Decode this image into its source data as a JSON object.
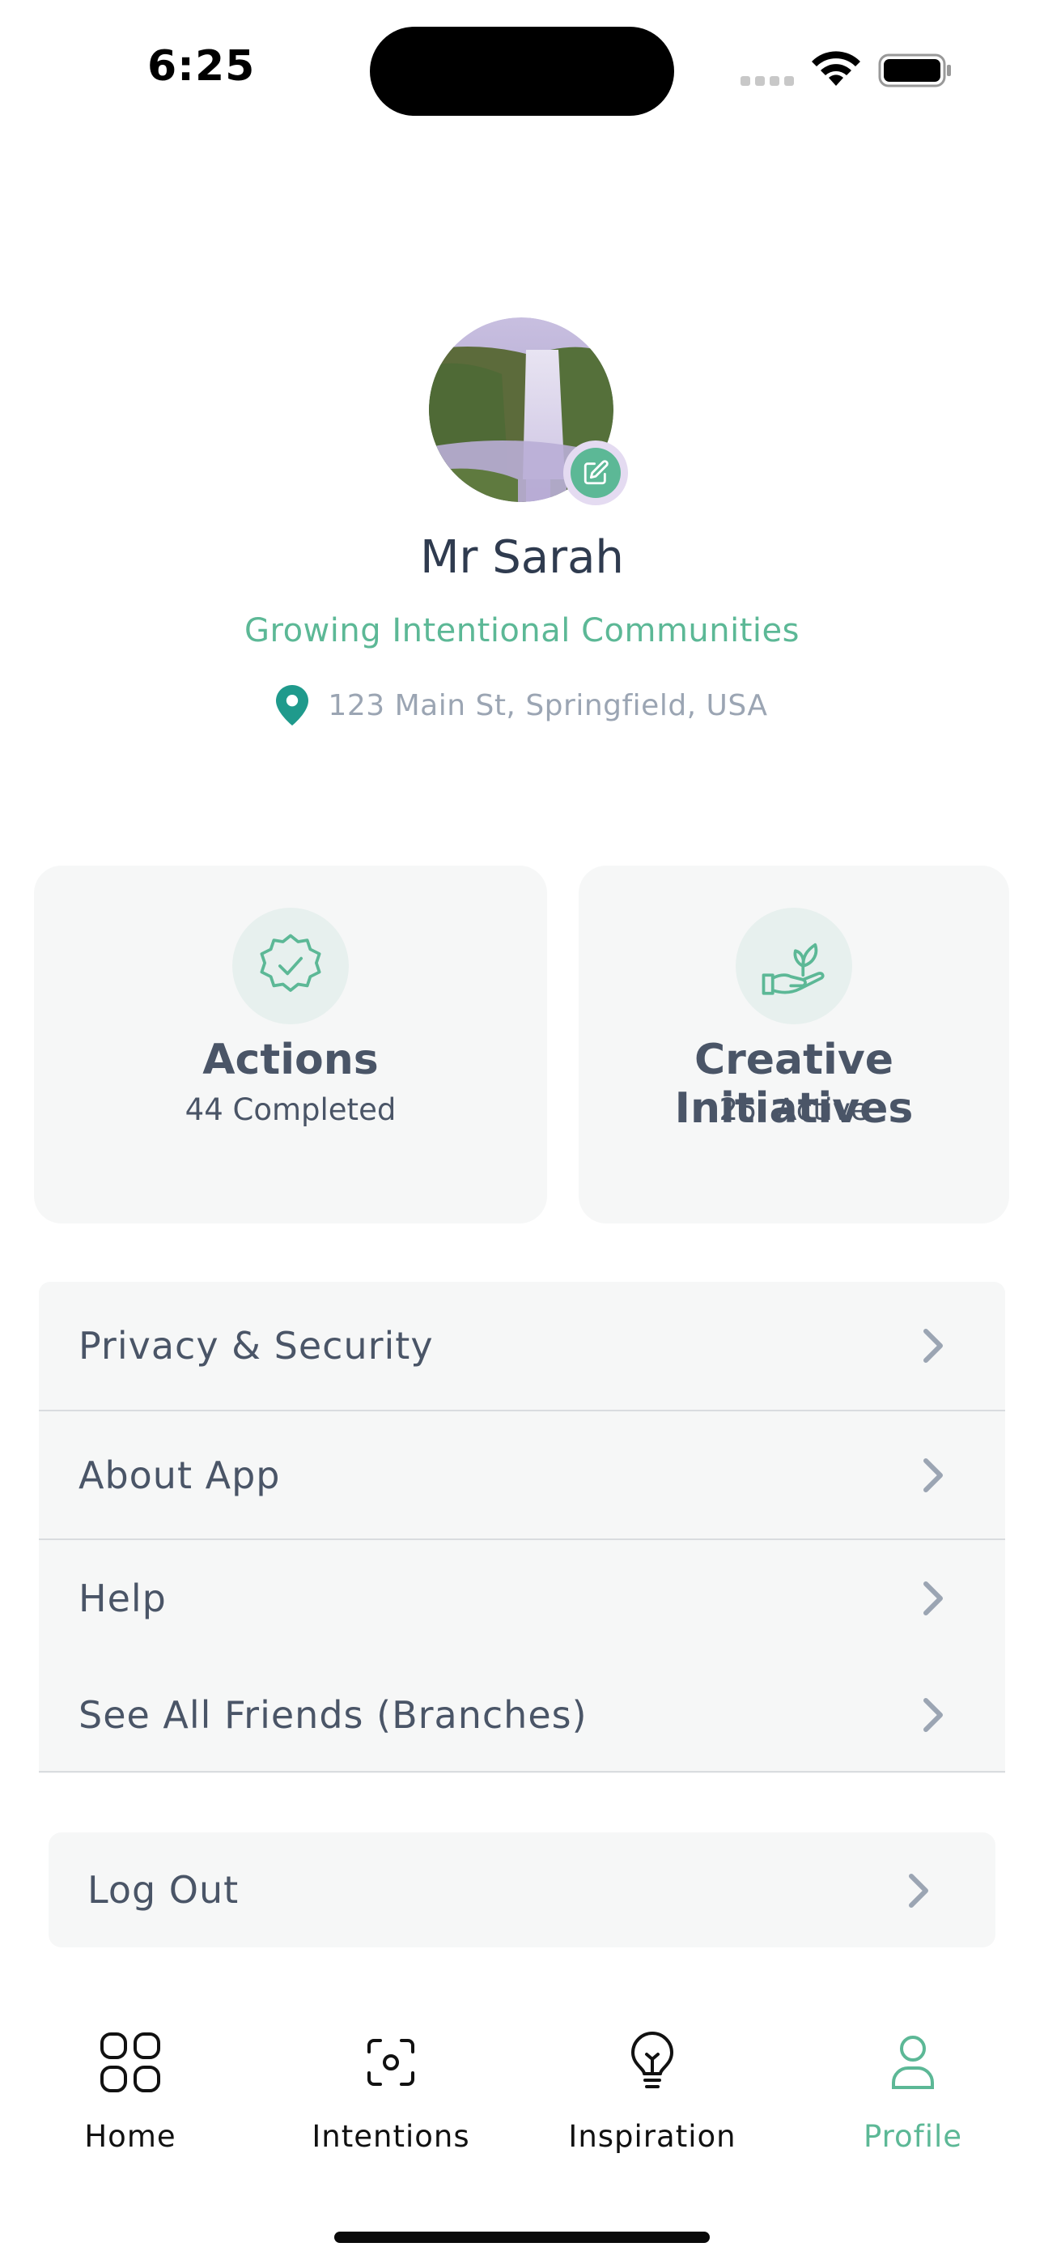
{
  "status_bar": {
    "time": "6:25"
  },
  "profile": {
    "name": "Mr Sarah",
    "tagline": "Growing Intentional Communities",
    "location": "123 Main St, Springfield, USA"
  },
  "stats": [
    {
      "title": "Actions",
      "subtitle": "44 Completed",
      "icon": "badge-check-icon"
    },
    {
      "title": "Creative Initiatives",
      "subtitle": "25  Active",
      "icon": "hand-sprout-icon"
    }
  ],
  "menu": {
    "items": [
      {
        "label": "Privacy & Security"
      },
      {
        "label": "About App"
      },
      {
        "label": "Help"
      },
      {
        "label": "See All Friends (Branches)"
      }
    ],
    "logout_label": "Log Out"
  },
  "tabbar": {
    "tabs": [
      {
        "label": "Home",
        "icon": "grid-icon"
      },
      {
        "label": "Intentions",
        "icon": "scan-icon"
      },
      {
        "label": "Inspiration",
        "icon": "lightbulb-icon"
      },
      {
        "label": "Profile",
        "icon": "user-icon"
      }
    ],
    "active": "Profile"
  },
  "colors": {
    "accent": "#5cb896",
    "card_bg": "#f6f7f7",
    "text": "#4a5567",
    "muted": "#9ba5b3"
  }
}
